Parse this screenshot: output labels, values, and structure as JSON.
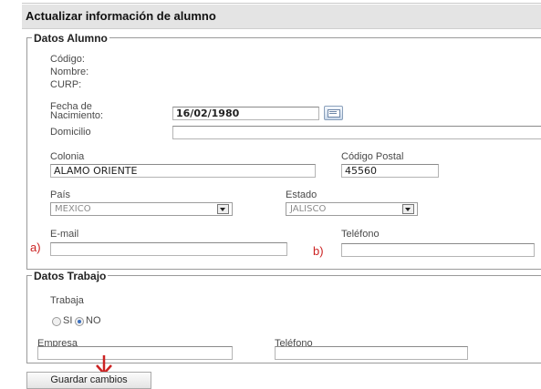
{
  "header": {
    "title": "Actualizar información de alumno"
  },
  "datos_alumno": {
    "legend": "Datos Alumno",
    "codigo_label": "Código:",
    "nombre_label": "Nombre:",
    "curp_label": "CURP:",
    "fecha_label_line1": "Fecha de",
    "fecha_label_line2": "Nacimiento:",
    "fecha_value": "16/02/1980",
    "domicilio_label": "Domicilio",
    "domicilio_value": "",
    "colonia_label": "Colonia",
    "colonia_value": "ALAMO ORIENTE",
    "cp_label": "Código Postal",
    "cp_value": "45560",
    "pais_label": "País",
    "pais_value": "MEXICO",
    "estado_label": "Estado",
    "estado_value": "JALISCO",
    "email_label": "E-mail",
    "email_value": "",
    "telefono_label": "Teléfono",
    "telefono_value": "",
    "marker_a": "a)",
    "marker_b": "b)"
  },
  "datos_trabajo": {
    "legend": "Datos Trabajo",
    "trabaja_label": "Trabaja",
    "si_label": "SI",
    "no_label": "NO",
    "selected": "NO",
    "empresa_label": "Empresa",
    "empresa_value": "",
    "telefono_label": "Teléfono",
    "telefono_value": ""
  },
  "actions": {
    "save_label": "Guardar cambios"
  },
  "colors": {
    "annotation": "#cc2222",
    "header_bg": "#e4e4e4"
  },
  "icons": {
    "date_picker": "calendar-icon",
    "dropdown": "chevron-down-icon",
    "annotation_arrow": "red-arrow-down-icon"
  }
}
